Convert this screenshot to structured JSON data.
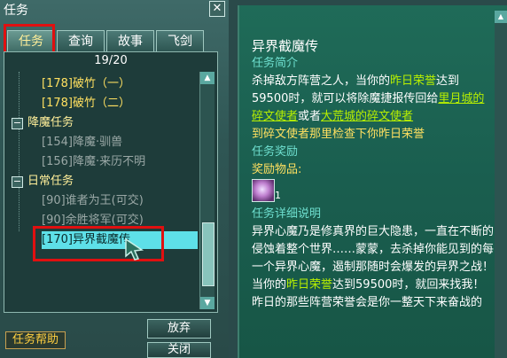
{
  "window": {
    "title": "任务",
    "close": "✕"
  },
  "tabs": [
    "任务",
    "查询",
    "故事",
    "飞剑"
  ],
  "list": {
    "counter": "19/20",
    "rows": [
      {
        "kind": "quest",
        "label": "[178]破竹（一）",
        "color": "yellow"
      },
      {
        "kind": "quest",
        "label": "[178]破竹（二）",
        "color": "yellow"
      },
      {
        "kind": "category",
        "label": "降魔任务"
      },
      {
        "kind": "quest",
        "label": "[154]降魔·驯兽",
        "color": "gray"
      },
      {
        "kind": "quest",
        "label": "[156]降魔·来历不明",
        "color": "gray"
      },
      {
        "kind": "category",
        "label": "日常任务"
      },
      {
        "kind": "quest",
        "label": "[90]谁者为王(可交)",
        "color": "gray"
      },
      {
        "kind": "quest",
        "label": "[90]余胜将军(可交)",
        "color": "gray"
      },
      {
        "kind": "quest",
        "label": "[170]异界截魔传",
        "color": "selected"
      }
    ]
  },
  "buttons": {
    "abandon": "放弃",
    "close": "关闭",
    "help": "任务帮助"
  },
  "detail": {
    "title": "异界截魔传",
    "section_intro": "任务简介",
    "intro_p1": "杀掉敌方阵营之人，当你的",
    "intro_p1_hl": "昨日荣誉",
    "intro_p1_tail": "达到59500时，就可以将除魔捷报传回给",
    "intro_loc1": "里月城的碎文使者",
    "intro_or": "或者",
    "intro_loc2": "大荒城的碎文使者",
    "intro_goal": "到碎文使者那里检查下你昨日荣誉",
    "section_reward": "任务奖励",
    "reward_label": "奖励物品:",
    "reward_icon": "purple-orb-icon",
    "reward_count": "1",
    "section_detail": "任务详细说明",
    "detail_p1": "异界心魔乃是修真界的巨大隐患，一直在不断的侵蚀着整个世界……蒙蒙，去杀掉你能见到的每一个异界心魔，遏制那随时会爆发的异界之战！当你的",
    "detail_hl": "昨日荣誉",
    "detail_p2": "达到59500时，就回来找我！昨日的那些阵营荣誉会是你一整天下来奋战的"
  }
}
